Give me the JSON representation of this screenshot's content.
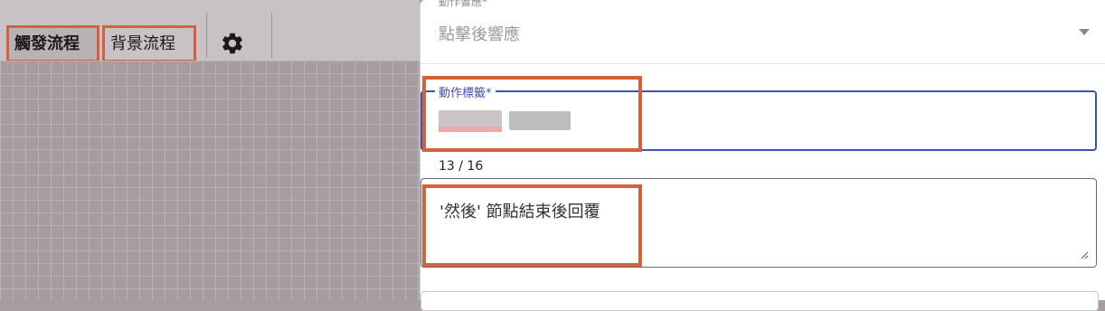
{
  "toolbar": {
    "tabs": [
      {
        "label": "觸發流程",
        "active": true
      },
      {
        "label": "背景流程",
        "active": false
      }
    ],
    "settings_icon": "gear-icon"
  },
  "panel": {
    "action_response": {
      "label": "動作響應*",
      "value": "點擊後響應"
    },
    "action_label": {
      "label": "動作標籤*",
      "value_blurred": true,
      "counter": "13 / 16"
    },
    "reply_textarea": {
      "value": "'然後' 節點結束後回覆"
    }
  },
  "colors": {
    "highlight": "#d4603c",
    "focus": "#3f51b5"
  }
}
